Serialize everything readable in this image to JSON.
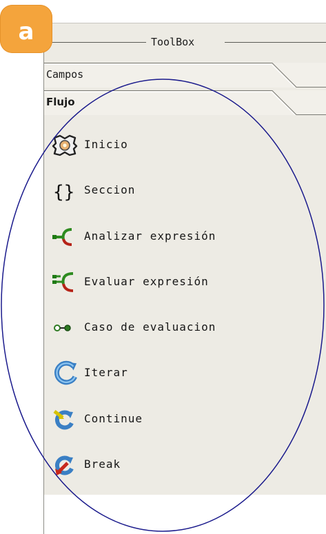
{
  "badge": {
    "letter": "a",
    "color": "#f4a43c"
  },
  "toolbox": {
    "title": "ToolBox",
    "tabs": [
      {
        "label": "Campos",
        "active": false
      },
      {
        "label": "Flujo",
        "active": true
      }
    ],
    "items": [
      {
        "label": "Inicio",
        "icon": "start-gear-icon"
      },
      {
        "label": "Seccion",
        "icon": "braces-icon"
      },
      {
        "label": "Analizar expresión",
        "icon": "branch-icon"
      },
      {
        "label": "Evaluar expresión",
        "icon": "multi-branch-icon"
      },
      {
        "label": "Caso de evaluacion",
        "icon": "case-link-icon"
      },
      {
        "label": "Iterar",
        "icon": "loop-arrow-icon"
      },
      {
        "label": "Continue",
        "icon": "continue-loop-icon"
      },
      {
        "label": "Break",
        "icon": "break-loop-icon"
      }
    ]
  },
  "annotation": {
    "shape": "ellipse",
    "color": "#1a1a8c"
  }
}
